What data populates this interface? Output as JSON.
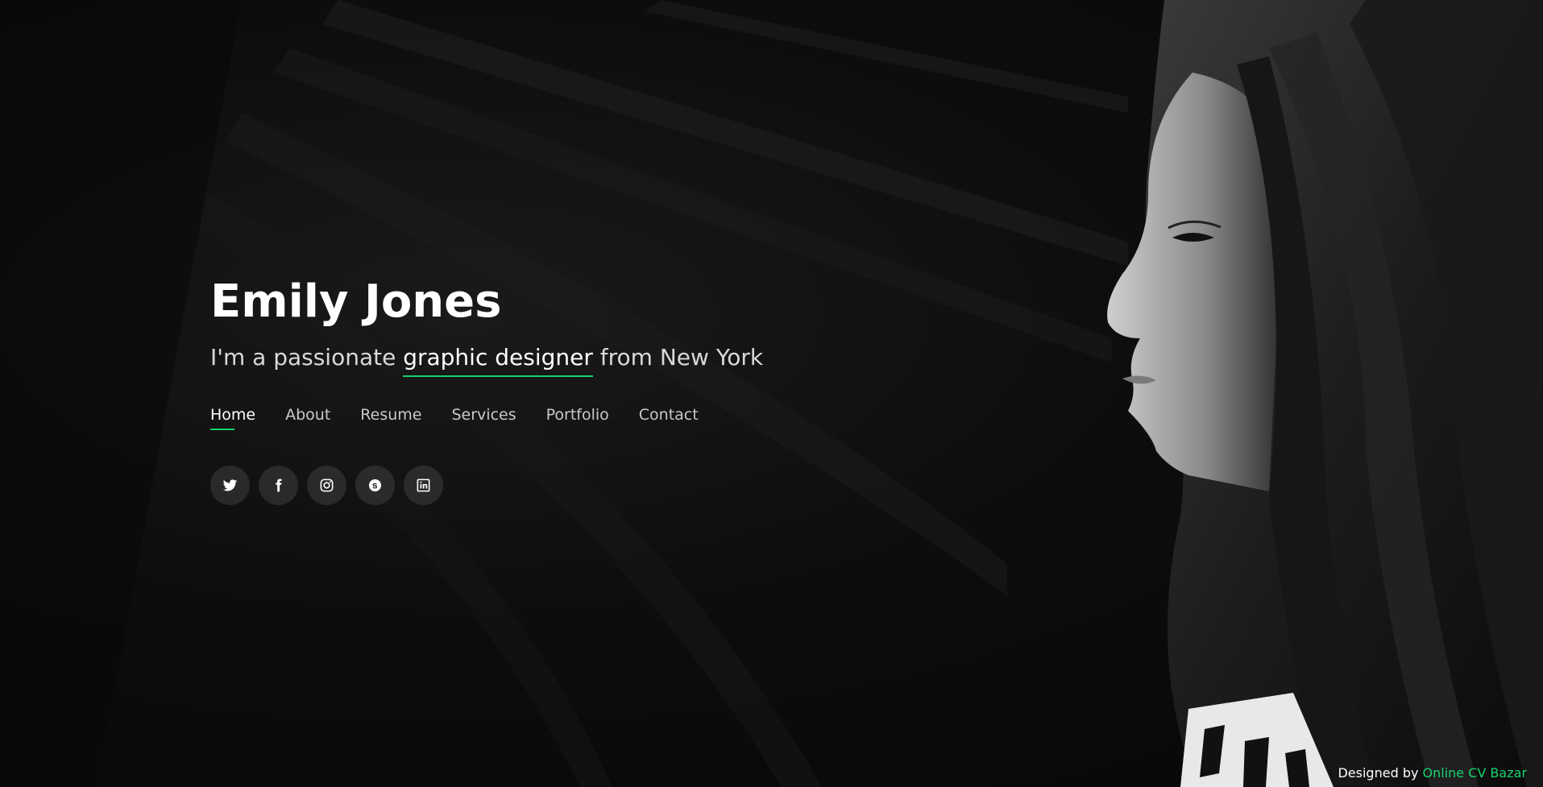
{
  "hero": {
    "name": "Emily Jones",
    "tagline_prefix": "I'm a passionate ",
    "tagline_highlight": "graphic designer",
    "tagline_suffix": " from New York"
  },
  "nav": {
    "items": [
      {
        "label": "Home",
        "active": true
      },
      {
        "label": "About",
        "active": false
      },
      {
        "label": "Resume",
        "active": false
      },
      {
        "label": "Services",
        "active": false
      },
      {
        "label": "Portfolio",
        "active": false
      },
      {
        "label": "Contact",
        "active": false
      }
    ]
  },
  "social": [
    {
      "icon": "twitter-icon"
    },
    {
      "icon": "facebook-icon"
    },
    {
      "icon": "instagram-icon"
    },
    {
      "icon": "skype-icon"
    },
    {
      "icon": "linkedin-icon"
    }
  ],
  "footer": {
    "credit_prefix": "Designed by ",
    "credit_link": "Online CV Bazar"
  },
  "colors": {
    "accent": "#18d26e",
    "background": "#0a0a0a",
    "text": "#ffffff"
  }
}
